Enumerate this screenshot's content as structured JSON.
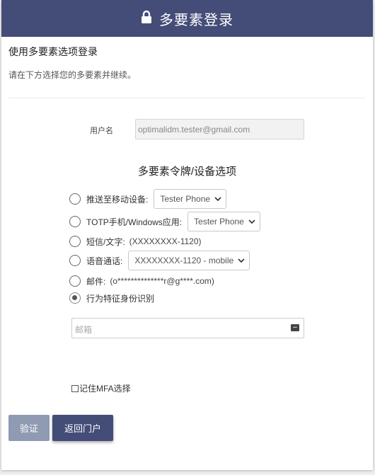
{
  "header": {
    "title": "多要素登录",
    "icon": "lock-icon",
    "background": "#444c78"
  },
  "subtitle": "使用多要素选项登录",
  "instruction": "请在下方选择您的多要素并继续。",
  "username": {
    "label": "用户名",
    "value": "optimalidm.tester@gmail.com"
  },
  "section_title": "多要素令牌/设备选项",
  "options": [
    {
      "label": "推送至移动设备:",
      "device": "Tester Phone",
      "selected": false
    },
    {
      "label": "TOTP手机/Windows应用:",
      "device": "Tester Phone",
      "selected": false
    },
    {
      "label": "短信/文字:",
      "detail": "(XXXXXXXX-1120)",
      "selected": false
    },
    {
      "label": "语音通话:",
      "device": "XXXXXXXX-1120 - mobile",
      "selected": false
    },
    {
      "label": "邮件:",
      "detail": "(o**************r@g****.com)",
      "selected": false
    },
    {
      "label": "行为特征身份识别",
      "selected": true
    }
  ],
  "email": {
    "placeholder": "邮箱"
  },
  "remember_label": "记住MFA选择",
  "buttons": {
    "verify": "验证",
    "back": "返回门户"
  }
}
